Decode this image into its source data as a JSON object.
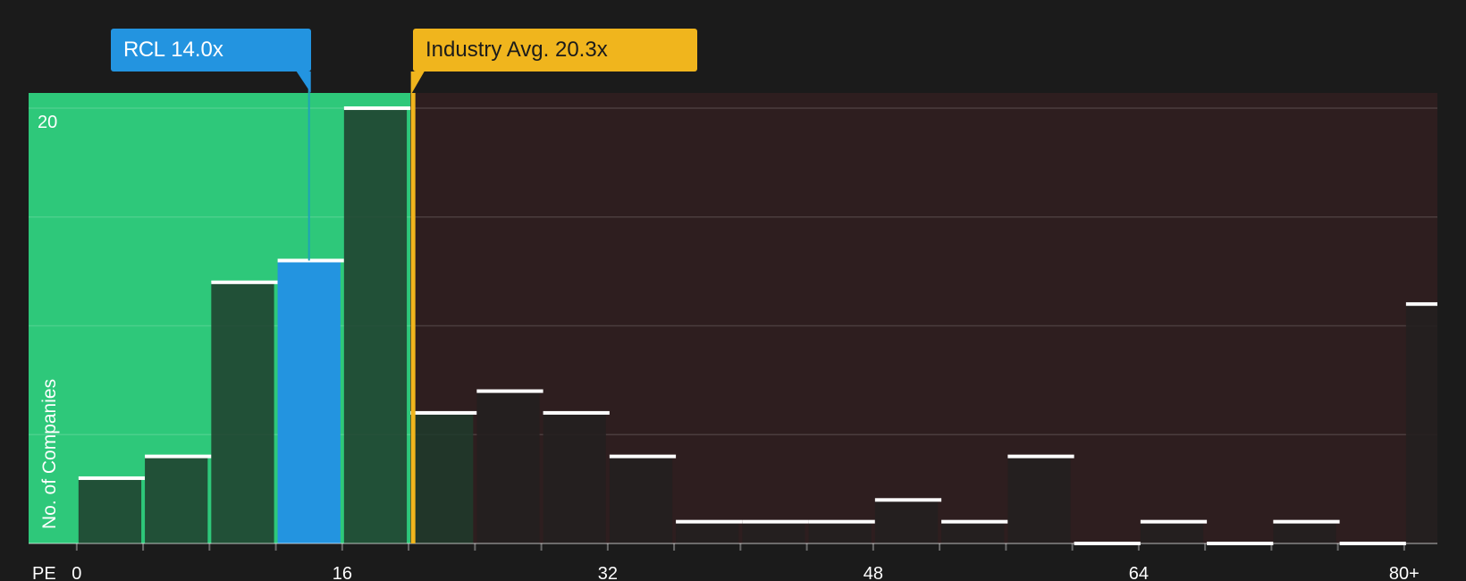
{
  "company": {
    "ticker": "RCL",
    "value_label": "14.0x",
    "pe": 14.0,
    "color": "#2394e0"
  },
  "industry": {
    "label": "Industry Avg.",
    "value_label": "20.3x",
    "pe": 20.3,
    "color": "#f0b51d"
  },
  "colors": {
    "background": "#1b1b1b",
    "below_zone": "#2ec87a",
    "above_zone": "#2e1e1f",
    "bar": "#1f3b2c",
    "bar_above": "#241f1f",
    "marker": "#ffffff"
  },
  "chart_data": {
    "type": "bar",
    "x_label": "PE",
    "y_label": "No. of Companies",
    "x_ticks": [
      "0",
      "16",
      "32",
      "48",
      "64",
      "80+"
    ],
    "x_tick_values": [
      0,
      16,
      32,
      48,
      64,
      80
    ],
    "y_ticks": [
      "20"
    ],
    "y_tick_values": [
      20
    ],
    "ylim": [
      0,
      20.7
    ],
    "xlim": [
      -2.9,
      82
    ],
    "bin_width": 4,
    "bins": [
      {
        "start": 0,
        "count": 3
      },
      {
        "start": 4,
        "count": 4
      },
      {
        "start": 8,
        "count": 12
      },
      {
        "start": 12,
        "count": 13,
        "highlight": true
      },
      {
        "start": 16,
        "count": 20
      },
      {
        "start": 20,
        "count": 6
      },
      {
        "start": 24,
        "count": 7
      },
      {
        "start": 28,
        "count": 6
      },
      {
        "start": 32,
        "count": 4
      },
      {
        "start": 36,
        "count": 1
      },
      {
        "start": 40,
        "count": 1
      },
      {
        "start": 44,
        "count": 1
      },
      {
        "start": 48,
        "count": 2
      },
      {
        "start": 52,
        "count": 1
      },
      {
        "start": 56,
        "count": 4
      },
      {
        "start": 60,
        "count": 0
      },
      {
        "start": 64,
        "count": 1
      },
      {
        "start": 68,
        "count": 0
      },
      {
        "start": 72,
        "count": 1
      },
      {
        "start": 76,
        "count": 0
      },
      {
        "start": 80,
        "count": 11
      }
    ]
  }
}
